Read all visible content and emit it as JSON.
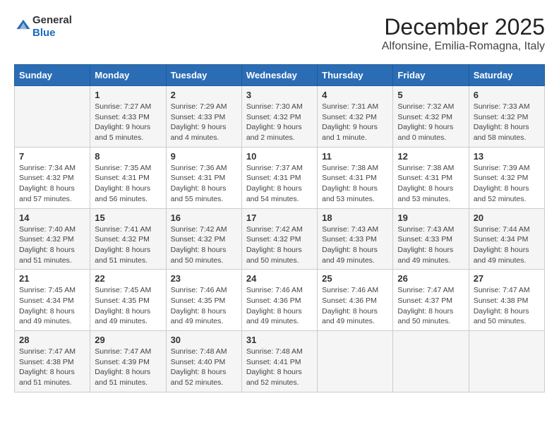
{
  "header": {
    "logo_general": "General",
    "logo_blue": "Blue",
    "month": "December 2025",
    "location": "Alfonsine, Emilia-Romagna, Italy"
  },
  "days_of_week": [
    "Sunday",
    "Monday",
    "Tuesday",
    "Wednesday",
    "Thursday",
    "Friday",
    "Saturday"
  ],
  "weeks": [
    [
      {
        "day": "",
        "info": ""
      },
      {
        "day": "1",
        "info": "Sunrise: 7:27 AM\nSunset: 4:33 PM\nDaylight: 9 hours\nand 5 minutes."
      },
      {
        "day": "2",
        "info": "Sunrise: 7:29 AM\nSunset: 4:33 PM\nDaylight: 9 hours\nand 4 minutes."
      },
      {
        "day": "3",
        "info": "Sunrise: 7:30 AM\nSunset: 4:32 PM\nDaylight: 9 hours\nand 2 minutes."
      },
      {
        "day": "4",
        "info": "Sunrise: 7:31 AM\nSunset: 4:32 PM\nDaylight: 9 hours\nand 1 minute."
      },
      {
        "day": "5",
        "info": "Sunrise: 7:32 AM\nSunset: 4:32 PM\nDaylight: 9 hours\nand 0 minutes."
      },
      {
        "day": "6",
        "info": "Sunrise: 7:33 AM\nSunset: 4:32 PM\nDaylight: 8 hours\nand 58 minutes."
      }
    ],
    [
      {
        "day": "7",
        "info": "Sunrise: 7:34 AM\nSunset: 4:32 PM\nDaylight: 8 hours\nand 57 minutes."
      },
      {
        "day": "8",
        "info": "Sunrise: 7:35 AM\nSunset: 4:31 PM\nDaylight: 8 hours\nand 56 minutes."
      },
      {
        "day": "9",
        "info": "Sunrise: 7:36 AM\nSunset: 4:31 PM\nDaylight: 8 hours\nand 55 minutes."
      },
      {
        "day": "10",
        "info": "Sunrise: 7:37 AM\nSunset: 4:31 PM\nDaylight: 8 hours\nand 54 minutes."
      },
      {
        "day": "11",
        "info": "Sunrise: 7:38 AM\nSunset: 4:31 PM\nDaylight: 8 hours\nand 53 minutes."
      },
      {
        "day": "12",
        "info": "Sunrise: 7:38 AM\nSunset: 4:31 PM\nDaylight: 8 hours\nand 53 minutes."
      },
      {
        "day": "13",
        "info": "Sunrise: 7:39 AM\nSunset: 4:32 PM\nDaylight: 8 hours\nand 52 minutes."
      }
    ],
    [
      {
        "day": "14",
        "info": "Sunrise: 7:40 AM\nSunset: 4:32 PM\nDaylight: 8 hours\nand 51 minutes."
      },
      {
        "day": "15",
        "info": "Sunrise: 7:41 AM\nSunset: 4:32 PM\nDaylight: 8 hours\nand 51 minutes."
      },
      {
        "day": "16",
        "info": "Sunrise: 7:42 AM\nSunset: 4:32 PM\nDaylight: 8 hours\nand 50 minutes."
      },
      {
        "day": "17",
        "info": "Sunrise: 7:42 AM\nSunset: 4:32 PM\nDaylight: 8 hours\nand 50 minutes."
      },
      {
        "day": "18",
        "info": "Sunrise: 7:43 AM\nSunset: 4:33 PM\nDaylight: 8 hours\nand 49 minutes."
      },
      {
        "day": "19",
        "info": "Sunrise: 7:43 AM\nSunset: 4:33 PM\nDaylight: 8 hours\nand 49 minutes."
      },
      {
        "day": "20",
        "info": "Sunrise: 7:44 AM\nSunset: 4:34 PM\nDaylight: 8 hours\nand 49 minutes."
      }
    ],
    [
      {
        "day": "21",
        "info": "Sunrise: 7:45 AM\nSunset: 4:34 PM\nDaylight: 8 hours\nand 49 minutes."
      },
      {
        "day": "22",
        "info": "Sunrise: 7:45 AM\nSunset: 4:35 PM\nDaylight: 8 hours\nand 49 minutes."
      },
      {
        "day": "23",
        "info": "Sunrise: 7:46 AM\nSunset: 4:35 PM\nDaylight: 8 hours\nand 49 minutes."
      },
      {
        "day": "24",
        "info": "Sunrise: 7:46 AM\nSunset: 4:36 PM\nDaylight: 8 hours\nand 49 minutes."
      },
      {
        "day": "25",
        "info": "Sunrise: 7:46 AM\nSunset: 4:36 PM\nDaylight: 8 hours\nand 49 minutes."
      },
      {
        "day": "26",
        "info": "Sunrise: 7:47 AM\nSunset: 4:37 PM\nDaylight: 8 hours\nand 50 minutes."
      },
      {
        "day": "27",
        "info": "Sunrise: 7:47 AM\nSunset: 4:38 PM\nDaylight: 8 hours\nand 50 minutes."
      }
    ],
    [
      {
        "day": "28",
        "info": "Sunrise: 7:47 AM\nSunset: 4:38 PM\nDaylight: 8 hours\nand 51 minutes."
      },
      {
        "day": "29",
        "info": "Sunrise: 7:47 AM\nSunset: 4:39 PM\nDaylight: 8 hours\nand 51 minutes."
      },
      {
        "day": "30",
        "info": "Sunrise: 7:48 AM\nSunset: 4:40 PM\nDaylight: 8 hours\nand 52 minutes."
      },
      {
        "day": "31",
        "info": "Sunrise: 7:48 AM\nSunset: 4:41 PM\nDaylight: 8 hours\nand 52 minutes."
      },
      {
        "day": "",
        "info": ""
      },
      {
        "day": "",
        "info": ""
      },
      {
        "day": "",
        "info": ""
      }
    ]
  ]
}
